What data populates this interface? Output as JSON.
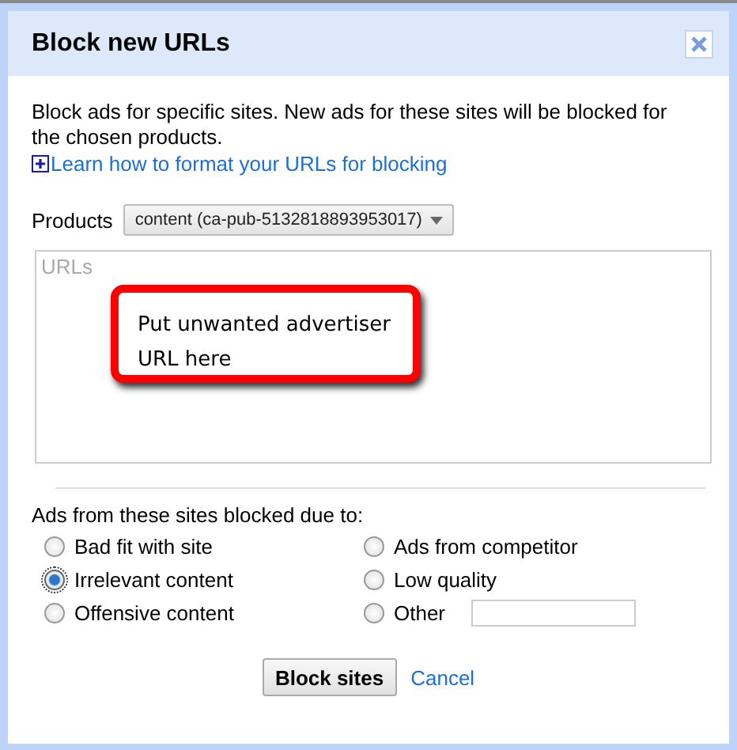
{
  "dialog": {
    "title": "Block new URLs",
    "description": "Block ads for specific sites. New ads for these sites will be blocked for the chosen products.",
    "help_link": "Learn how to format your URLs for blocking",
    "products": {
      "label": "Products",
      "value": "content (ca-pub-5132818893953017)"
    },
    "urls": {
      "placeholder": "URLs"
    },
    "callout": "Put unwanted advertiser URL here",
    "reasons": {
      "label": "Ads from these sites blocked due to:",
      "options": [
        {
          "label": "Bad fit with site",
          "kind": "plain",
          "selected": false
        },
        {
          "label": "Ads from competitor",
          "kind": "plain",
          "selected": false
        },
        {
          "label": "Irrelevant content",
          "kind": "plain",
          "selected": true
        },
        {
          "label": "Low quality",
          "kind": "plain",
          "selected": false
        },
        {
          "label": "Offensive content",
          "kind": "plain",
          "selected": false
        },
        {
          "label": "Other",
          "kind": "with_field",
          "selected": false
        }
      ]
    },
    "buttons": {
      "primary": "Block sites",
      "cancel": "Cancel"
    }
  }
}
